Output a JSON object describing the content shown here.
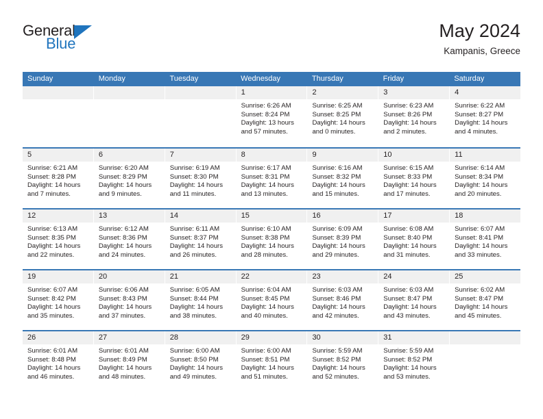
{
  "logo": {
    "word1": "General",
    "word2": "Blue",
    "triangle_color": "#1f74bd",
    "word1_color": "#231f20",
    "word2_color": "#1f74bd"
  },
  "header": {
    "title": "May 2024",
    "subtitle": "Kampanis, Greece"
  },
  "theme": {
    "header_bar": "#3877b5",
    "daynum_band": "#f0f0f0",
    "text": "#231f20"
  },
  "weekdays": [
    "Sunday",
    "Monday",
    "Tuesday",
    "Wednesday",
    "Thursday",
    "Friday",
    "Saturday"
  ],
  "weeks": [
    [
      {
        "day": "",
        "info": ""
      },
      {
        "day": "",
        "info": ""
      },
      {
        "day": "",
        "info": ""
      },
      {
        "day": "1",
        "info": "Sunrise: 6:26 AM\nSunset: 8:24 PM\nDaylight: 13 hours\nand 57 minutes."
      },
      {
        "day": "2",
        "info": "Sunrise: 6:25 AM\nSunset: 8:25 PM\nDaylight: 14 hours\nand 0 minutes."
      },
      {
        "day": "3",
        "info": "Sunrise: 6:23 AM\nSunset: 8:26 PM\nDaylight: 14 hours\nand 2 minutes."
      },
      {
        "day": "4",
        "info": "Sunrise: 6:22 AM\nSunset: 8:27 PM\nDaylight: 14 hours\nand 4 minutes."
      }
    ],
    [
      {
        "day": "5",
        "info": "Sunrise: 6:21 AM\nSunset: 8:28 PM\nDaylight: 14 hours\nand 7 minutes."
      },
      {
        "day": "6",
        "info": "Sunrise: 6:20 AM\nSunset: 8:29 PM\nDaylight: 14 hours\nand 9 minutes."
      },
      {
        "day": "7",
        "info": "Sunrise: 6:19 AM\nSunset: 8:30 PM\nDaylight: 14 hours\nand 11 minutes."
      },
      {
        "day": "8",
        "info": "Sunrise: 6:17 AM\nSunset: 8:31 PM\nDaylight: 14 hours\nand 13 minutes."
      },
      {
        "day": "9",
        "info": "Sunrise: 6:16 AM\nSunset: 8:32 PM\nDaylight: 14 hours\nand 15 minutes."
      },
      {
        "day": "10",
        "info": "Sunrise: 6:15 AM\nSunset: 8:33 PM\nDaylight: 14 hours\nand 17 minutes."
      },
      {
        "day": "11",
        "info": "Sunrise: 6:14 AM\nSunset: 8:34 PM\nDaylight: 14 hours\nand 20 minutes."
      }
    ],
    [
      {
        "day": "12",
        "info": "Sunrise: 6:13 AM\nSunset: 8:35 PM\nDaylight: 14 hours\nand 22 minutes."
      },
      {
        "day": "13",
        "info": "Sunrise: 6:12 AM\nSunset: 8:36 PM\nDaylight: 14 hours\nand 24 minutes."
      },
      {
        "day": "14",
        "info": "Sunrise: 6:11 AM\nSunset: 8:37 PM\nDaylight: 14 hours\nand 26 minutes."
      },
      {
        "day": "15",
        "info": "Sunrise: 6:10 AM\nSunset: 8:38 PM\nDaylight: 14 hours\nand 28 minutes."
      },
      {
        "day": "16",
        "info": "Sunrise: 6:09 AM\nSunset: 8:39 PM\nDaylight: 14 hours\nand 29 minutes."
      },
      {
        "day": "17",
        "info": "Sunrise: 6:08 AM\nSunset: 8:40 PM\nDaylight: 14 hours\nand 31 minutes."
      },
      {
        "day": "18",
        "info": "Sunrise: 6:07 AM\nSunset: 8:41 PM\nDaylight: 14 hours\nand 33 minutes."
      }
    ],
    [
      {
        "day": "19",
        "info": "Sunrise: 6:07 AM\nSunset: 8:42 PM\nDaylight: 14 hours\nand 35 minutes."
      },
      {
        "day": "20",
        "info": "Sunrise: 6:06 AM\nSunset: 8:43 PM\nDaylight: 14 hours\nand 37 minutes."
      },
      {
        "day": "21",
        "info": "Sunrise: 6:05 AM\nSunset: 8:44 PM\nDaylight: 14 hours\nand 38 minutes."
      },
      {
        "day": "22",
        "info": "Sunrise: 6:04 AM\nSunset: 8:45 PM\nDaylight: 14 hours\nand 40 minutes."
      },
      {
        "day": "23",
        "info": "Sunrise: 6:03 AM\nSunset: 8:46 PM\nDaylight: 14 hours\nand 42 minutes."
      },
      {
        "day": "24",
        "info": "Sunrise: 6:03 AM\nSunset: 8:47 PM\nDaylight: 14 hours\nand 43 minutes."
      },
      {
        "day": "25",
        "info": "Sunrise: 6:02 AM\nSunset: 8:47 PM\nDaylight: 14 hours\nand 45 minutes."
      }
    ],
    [
      {
        "day": "26",
        "info": "Sunrise: 6:01 AM\nSunset: 8:48 PM\nDaylight: 14 hours\nand 46 minutes."
      },
      {
        "day": "27",
        "info": "Sunrise: 6:01 AM\nSunset: 8:49 PM\nDaylight: 14 hours\nand 48 minutes."
      },
      {
        "day": "28",
        "info": "Sunrise: 6:00 AM\nSunset: 8:50 PM\nDaylight: 14 hours\nand 49 minutes."
      },
      {
        "day": "29",
        "info": "Sunrise: 6:00 AM\nSunset: 8:51 PM\nDaylight: 14 hours\nand 51 minutes."
      },
      {
        "day": "30",
        "info": "Sunrise: 5:59 AM\nSunset: 8:52 PM\nDaylight: 14 hours\nand 52 minutes."
      },
      {
        "day": "31",
        "info": "Sunrise: 5:59 AM\nSunset: 8:52 PM\nDaylight: 14 hours\nand 53 minutes."
      },
      {
        "day": "",
        "info": ""
      }
    ]
  ]
}
